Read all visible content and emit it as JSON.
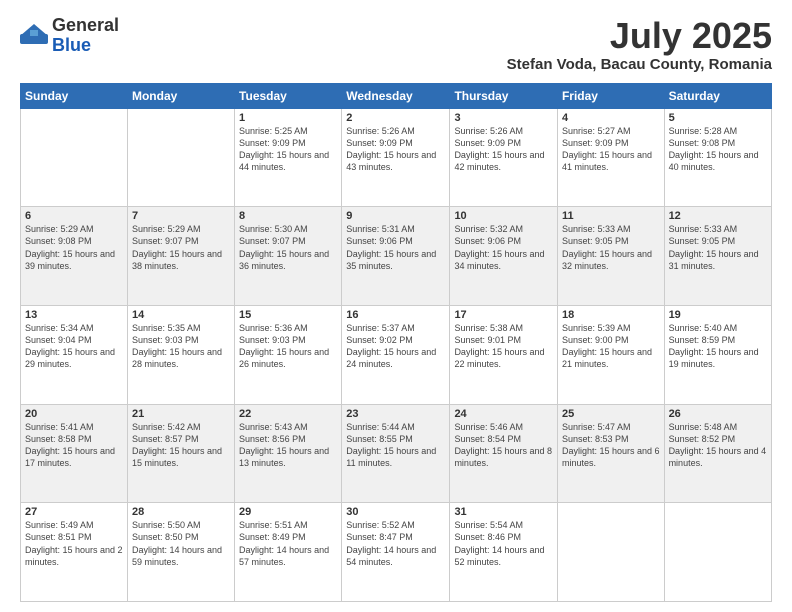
{
  "logo": {
    "general": "General",
    "blue": "Blue"
  },
  "header": {
    "month_year": "July 2025",
    "location": "Stefan Voda, Bacau County, Romania"
  },
  "weekdays": [
    "Sunday",
    "Monday",
    "Tuesday",
    "Wednesday",
    "Thursday",
    "Friday",
    "Saturday"
  ],
  "weeks": [
    [
      {
        "day": "",
        "sunrise": "",
        "sunset": "",
        "daylight": ""
      },
      {
        "day": "",
        "sunrise": "",
        "sunset": "",
        "daylight": ""
      },
      {
        "day": "1",
        "sunrise": "Sunrise: 5:25 AM",
        "sunset": "Sunset: 9:09 PM",
        "daylight": "Daylight: 15 hours and 44 minutes."
      },
      {
        "day": "2",
        "sunrise": "Sunrise: 5:26 AM",
        "sunset": "Sunset: 9:09 PM",
        "daylight": "Daylight: 15 hours and 43 minutes."
      },
      {
        "day": "3",
        "sunrise": "Sunrise: 5:26 AM",
        "sunset": "Sunset: 9:09 PM",
        "daylight": "Daylight: 15 hours and 42 minutes."
      },
      {
        "day": "4",
        "sunrise": "Sunrise: 5:27 AM",
        "sunset": "Sunset: 9:09 PM",
        "daylight": "Daylight: 15 hours and 41 minutes."
      },
      {
        "day": "5",
        "sunrise": "Sunrise: 5:28 AM",
        "sunset": "Sunset: 9:08 PM",
        "daylight": "Daylight: 15 hours and 40 minutes."
      }
    ],
    [
      {
        "day": "6",
        "sunrise": "Sunrise: 5:29 AM",
        "sunset": "Sunset: 9:08 PM",
        "daylight": "Daylight: 15 hours and 39 minutes."
      },
      {
        "day": "7",
        "sunrise": "Sunrise: 5:29 AM",
        "sunset": "Sunset: 9:07 PM",
        "daylight": "Daylight: 15 hours and 38 minutes."
      },
      {
        "day": "8",
        "sunrise": "Sunrise: 5:30 AM",
        "sunset": "Sunset: 9:07 PM",
        "daylight": "Daylight: 15 hours and 36 minutes."
      },
      {
        "day": "9",
        "sunrise": "Sunrise: 5:31 AM",
        "sunset": "Sunset: 9:06 PM",
        "daylight": "Daylight: 15 hours and 35 minutes."
      },
      {
        "day": "10",
        "sunrise": "Sunrise: 5:32 AM",
        "sunset": "Sunset: 9:06 PM",
        "daylight": "Daylight: 15 hours and 34 minutes."
      },
      {
        "day": "11",
        "sunrise": "Sunrise: 5:33 AM",
        "sunset": "Sunset: 9:05 PM",
        "daylight": "Daylight: 15 hours and 32 minutes."
      },
      {
        "day": "12",
        "sunrise": "Sunrise: 5:33 AM",
        "sunset": "Sunset: 9:05 PM",
        "daylight": "Daylight: 15 hours and 31 minutes."
      }
    ],
    [
      {
        "day": "13",
        "sunrise": "Sunrise: 5:34 AM",
        "sunset": "Sunset: 9:04 PM",
        "daylight": "Daylight: 15 hours and 29 minutes."
      },
      {
        "day": "14",
        "sunrise": "Sunrise: 5:35 AM",
        "sunset": "Sunset: 9:03 PM",
        "daylight": "Daylight: 15 hours and 28 minutes."
      },
      {
        "day": "15",
        "sunrise": "Sunrise: 5:36 AM",
        "sunset": "Sunset: 9:03 PM",
        "daylight": "Daylight: 15 hours and 26 minutes."
      },
      {
        "day": "16",
        "sunrise": "Sunrise: 5:37 AM",
        "sunset": "Sunset: 9:02 PM",
        "daylight": "Daylight: 15 hours and 24 minutes."
      },
      {
        "day": "17",
        "sunrise": "Sunrise: 5:38 AM",
        "sunset": "Sunset: 9:01 PM",
        "daylight": "Daylight: 15 hours and 22 minutes."
      },
      {
        "day": "18",
        "sunrise": "Sunrise: 5:39 AM",
        "sunset": "Sunset: 9:00 PM",
        "daylight": "Daylight: 15 hours and 21 minutes."
      },
      {
        "day": "19",
        "sunrise": "Sunrise: 5:40 AM",
        "sunset": "Sunset: 8:59 PM",
        "daylight": "Daylight: 15 hours and 19 minutes."
      }
    ],
    [
      {
        "day": "20",
        "sunrise": "Sunrise: 5:41 AM",
        "sunset": "Sunset: 8:58 PM",
        "daylight": "Daylight: 15 hours and 17 minutes."
      },
      {
        "day": "21",
        "sunrise": "Sunrise: 5:42 AM",
        "sunset": "Sunset: 8:57 PM",
        "daylight": "Daylight: 15 hours and 15 minutes."
      },
      {
        "day": "22",
        "sunrise": "Sunrise: 5:43 AM",
        "sunset": "Sunset: 8:56 PM",
        "daylight": "Daylight: 15 hours and 13 minutes."
      },
      {
        "day": "23",
        "sunrise": "Sunrise: 5:44 AM",
        "sunset": "Sunset: 8:55 PM",
        "daylight": "Daylight: 15 hours and 11 minutes."
      },
      {
        "day": "24",
        "sunrise": "Sunrise: 5:46 AM",
        "sunset": "Sunset: 8:54 PM",
        "daylight": "Daylight: 15 hours and 8 minutes."
      },
      {
        "day": "25",
        "sunrise": "Sunrise: 5:47 AM",
        "sunset": "Sunset: 8:53 PM",
        "daylight": "Daylight: 15 hours and 6 minutes."
      },
      {
        "day": "26",
        "sunrise": "Sunrise: 5:48 AM",
        "sunset": "Sunset: 8:52 PM",
        "daylight": "Daylight: 15 hours and 4 minutes."
      }
    ],
    [
      {
        "day": "27",
        "sunrise": "Sunrise: 5:49 AM",
        "sunset": "Sunset: 8:51 PM",
        "daylight": "Daylight: 15 hours and 2 minutes."
      },
      {
        "day": "28",
        "sunrise": "Sunrise: 5:50 AM",
        "sunset": "Sunset: 8:50 PM",
        "daylight": "Daylight: 14 hours and 59 minutes."
      },
      {
        "day": "29",
        "sunrise": "Sunrise: 5:51 AM",
        "sunset": "Sunset: 8:49 PM",
        "daylight": "Daylight: 14 hours and 57 minutes."
      },
      {
        "day": "30",
        "sunrise": "Sunrise: 5:52 AM",
        "sunset": "Sunset: 8:47 PM",
        "daylight": "Daylight: 14 hours and 54 minutes."
      },
      {
        "day": "31",
        "sunrise": "Sunrise: 5:54 AM",
        "sunset": "Sunset: 8:46 PM",
        "daylight": "Daylight: 14 hours and 52 minutes."
      },
      {
        "day": "",
        "sunrise": "",
        "sunset": "",
        "daylight": ""
      },
      {
        "day": "",
        "sunrise": "",
        "sunset": "",
        "daylight": ""
      }
    ]
  ]
}
